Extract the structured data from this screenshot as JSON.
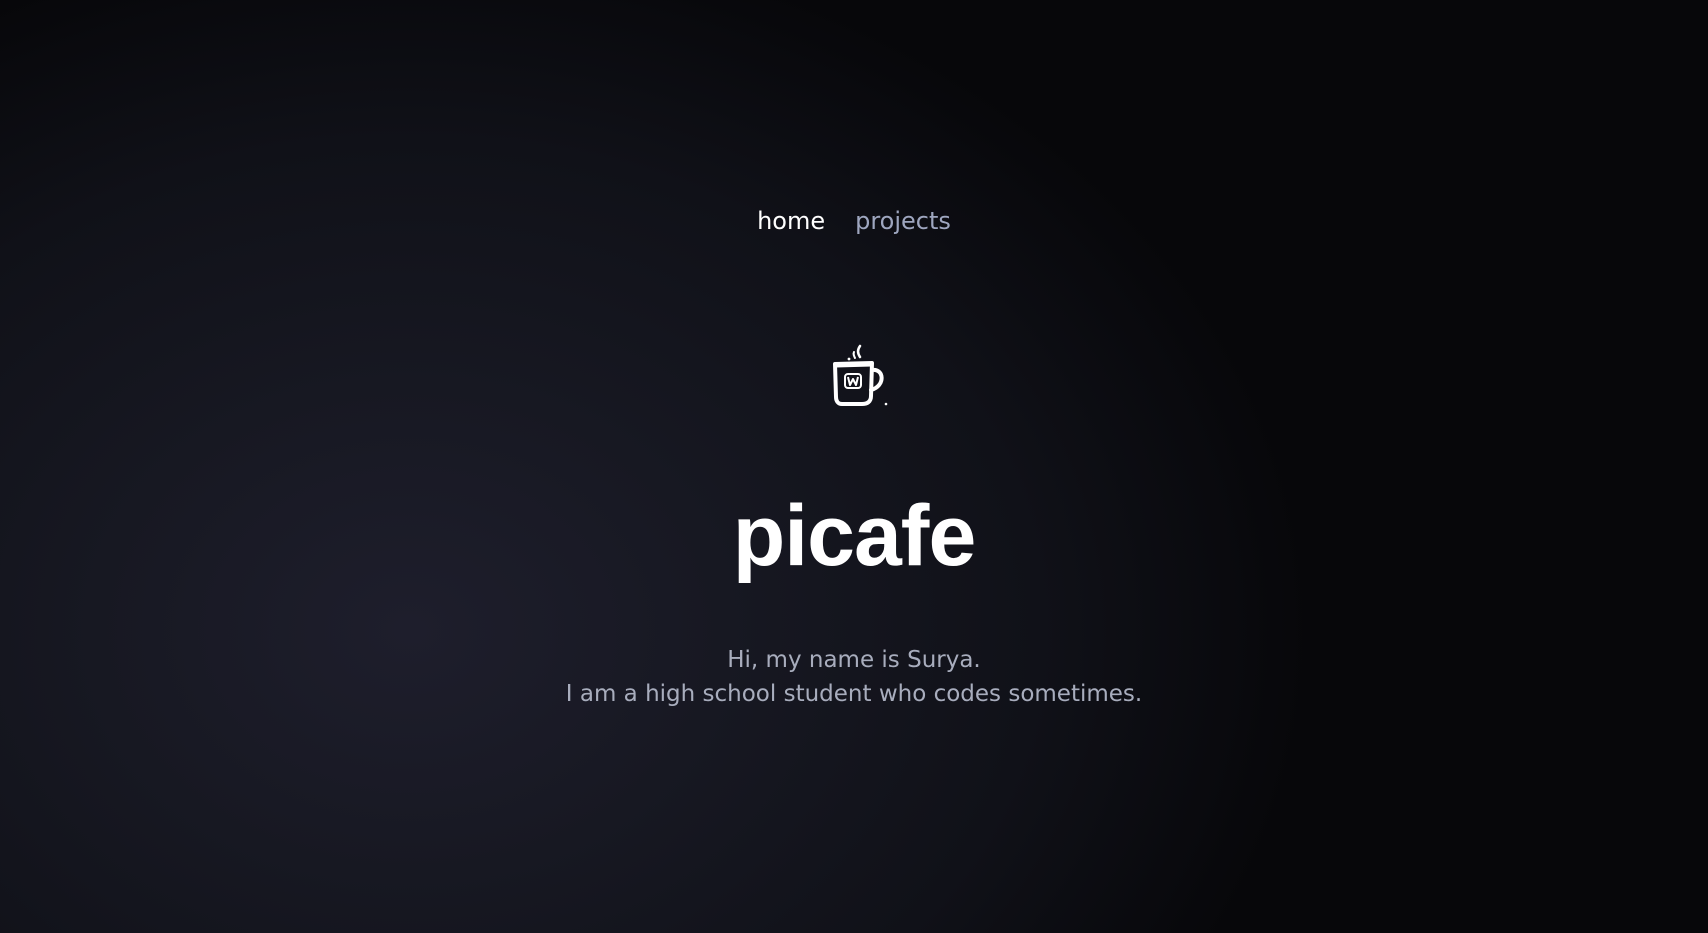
{
  "nav": {
    "items": [
      {
        "label": "home",
        "active": true
      },
      {
        "label": "projects",
        "active": false
      }
    ]
  },
  "hero": {
    "logo_icon": "coffee-cup-icon",
    "title": "picafe"
  },
  "intro": {
    "line1": "Hi, my name is Surya.",
    "line2": "I am a high school student who codes sometimes."
  },
  "colors": {
    "background": "#14151d",
    "text_primary": "#ffffff",
    "text_muted": "#a8adbd",
    "nav_inactive": "#9ea6bf"
  }
}
